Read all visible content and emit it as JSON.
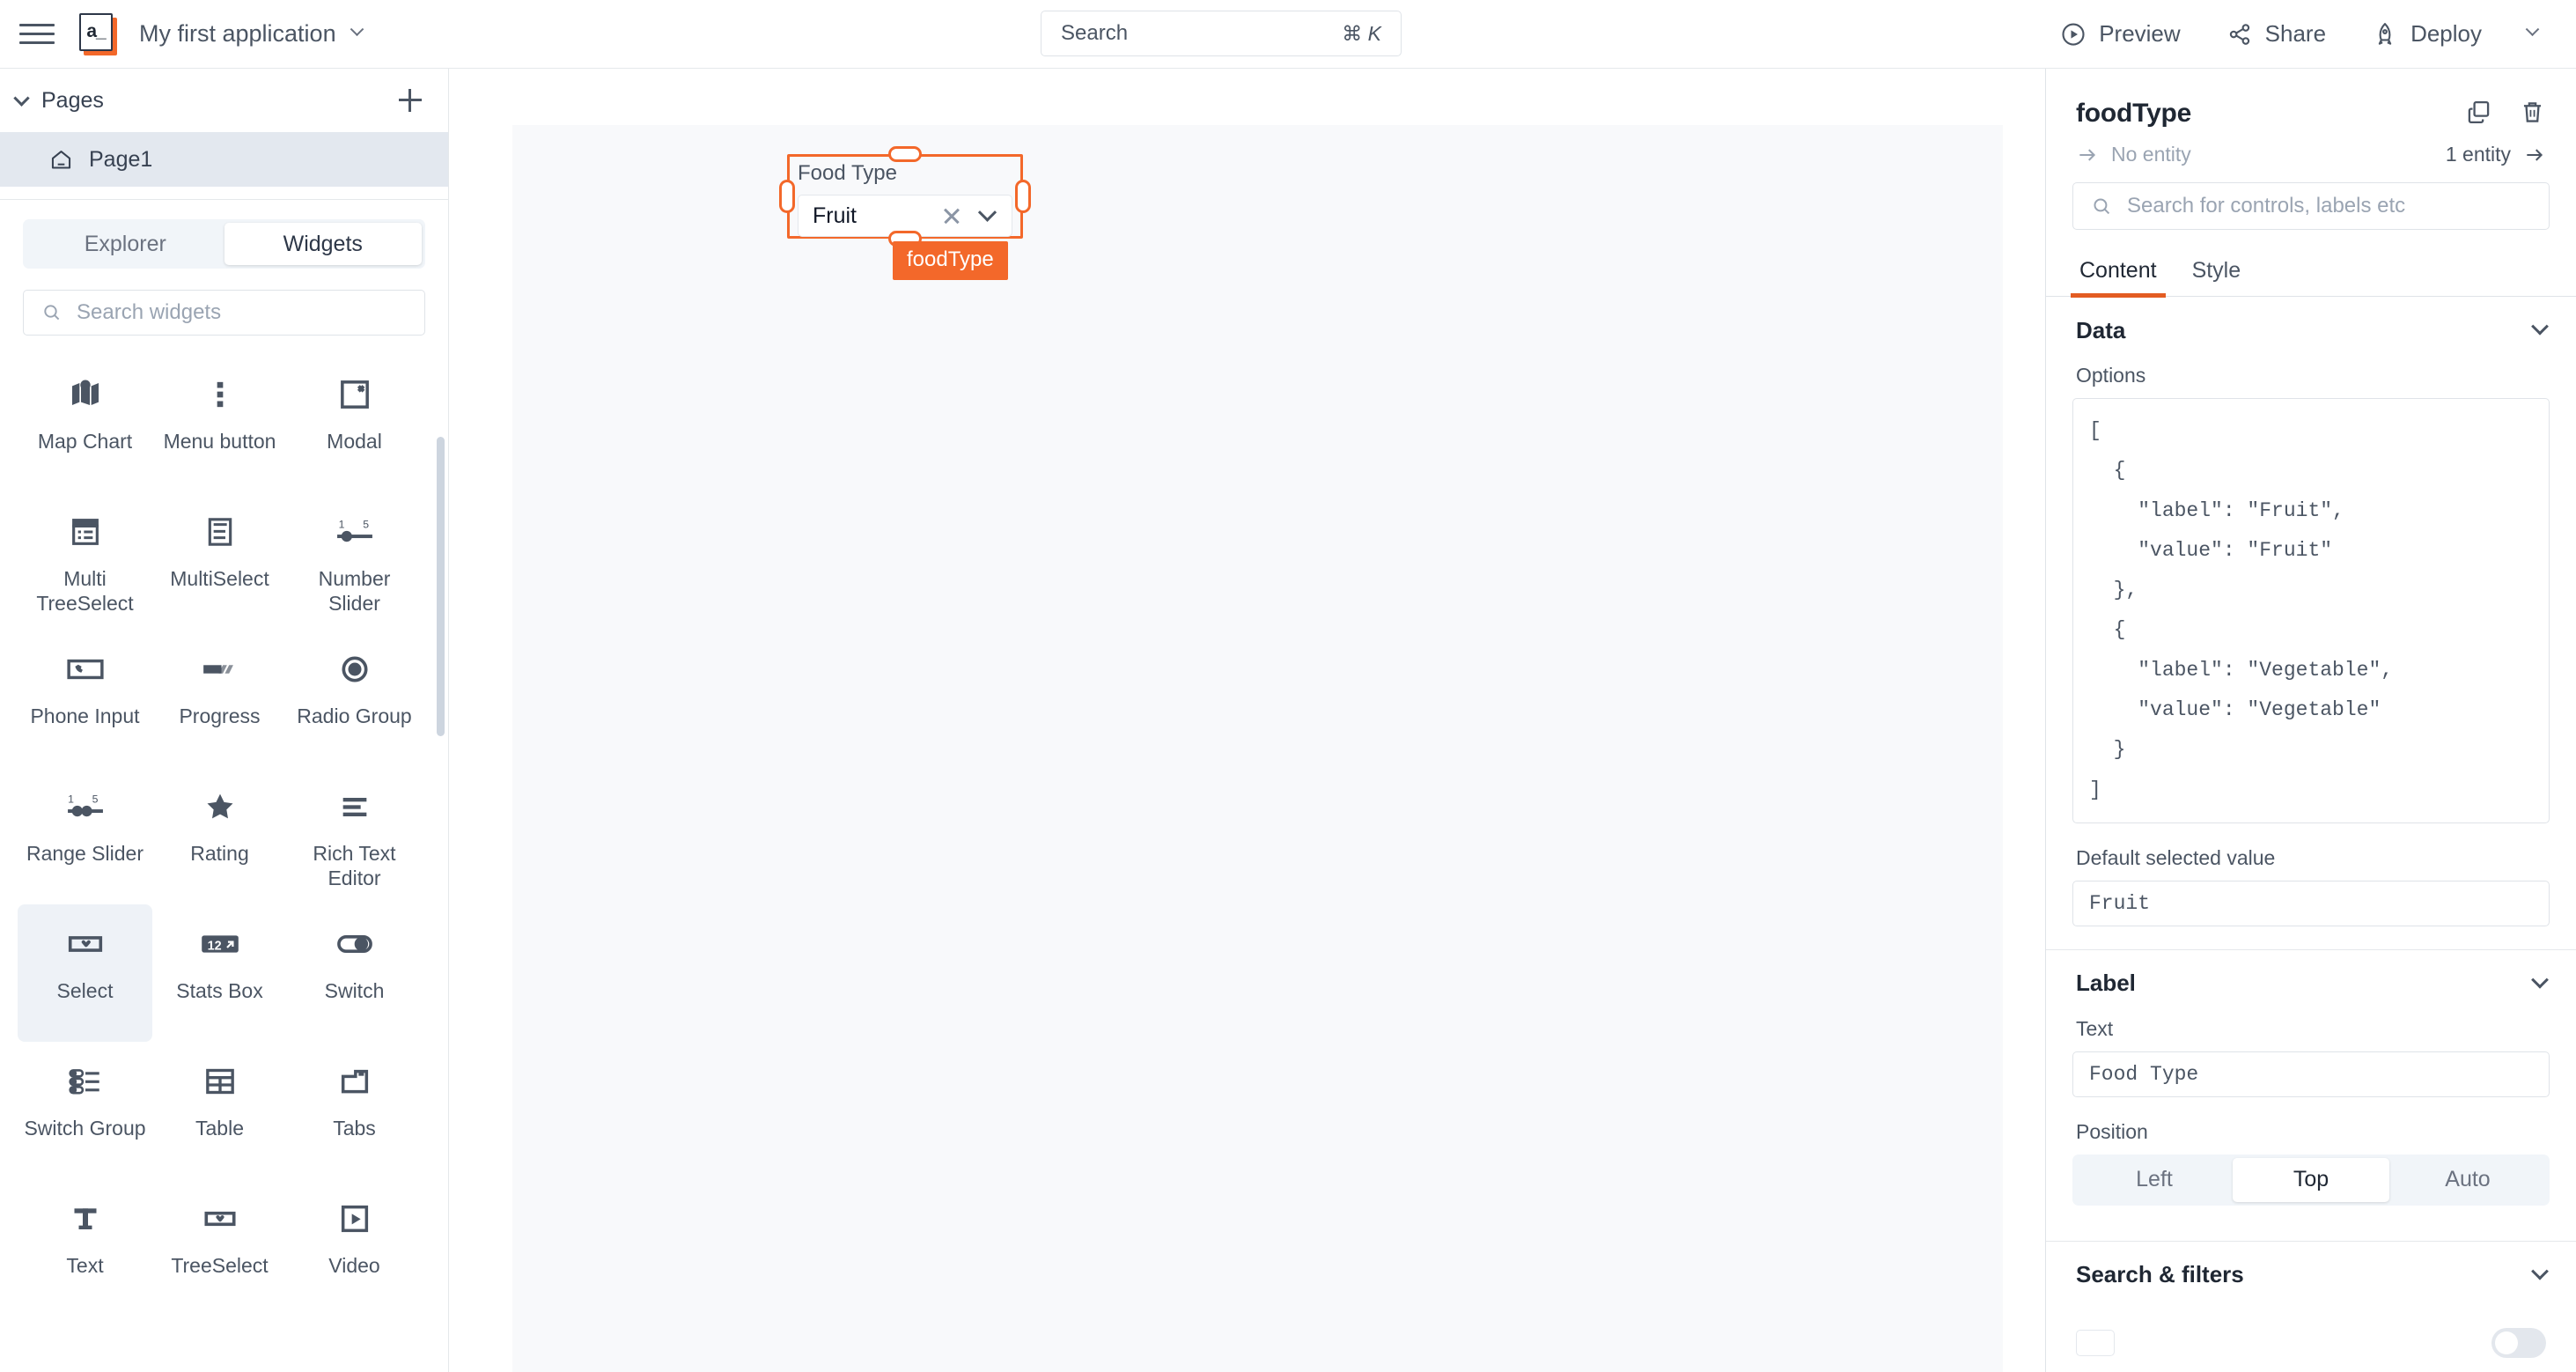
{
  "topbar": {
    "menu_icon": "hamburger-icon",
    "logo_text": "a_",
    "app_title": "My first application",
    "app_title_chevron": "chevron-down-icon",
    "search": {
      "placeholder": "Search",
      "shortcut_mod": "⌘",
      "shortcut_key": "K"
    },
    "actions": [
      {
        "label": "Preview",
        "icon": "play-circle-icon"
      },
      {
        "label": "Share",
        "icon": "share-nodes-icon"
      },
      {
        "label": "Deploy",
        "icon": "rocket-icon"
      }
    ],
    "more_chevron": "chevron-down-icon"
  },
  "sidebar": {
    "pages": {
      "title": "Pages",
      "collapse_icon": "chevron-down-icon",
      "add_icon": "plus-icon"
    },
    "page_items": [
      {
        "label": "Page1",
        "icon": "home-icon",
        "active": true
      }
    ],
    "tabs": [
      {
        "label": "Explorer",
        "active": false
      },
      {
        "label": "Widgets",
        "active": true
      }
    ],
    "search": {
      "placeholder": "Search widgets",
      "icon": "search-icon"
    },
    "widgets": [
      {
        "label": "Map Chart",
        "icon": "map-chart-icon",
        "selected": false
      },
      {
        "label": "Menu button",
        "icon": "dots-vertical-icon",
        "selected": false
      },
      {
        "label": "Modal",
        "icon": "modal-icon",
        "selected": false
      },
      {
        "label": "Multi TreeSelect",
        "icon": "multi-treeselect-icon",
        "selected": false
      },
      {
        "label": "MultiSelect",
        "icon": "multiselect-icon",
        "selected": false
      },
      {
        "label": "Number Slider",
        "icon": "number-slider-icon",
        "selected": false
      },
      {
        "label": "Phone Input",
        "icon": "phone-input-icon",
        "selected": false
      },
      {
        "label": "Progress",
        "icon": "progress-icon",
        "selected": false
      },
      {
        "label": "Radio Group",
        "icon": "radio-group-icon",
        "selected": false
      },
      {
        "label": "Range Slider",
        "icon": "range-slider-icon",
        "selected": false
      },
      {
        "label": "Rating",
        "icon": "star-icon",
        "selected": false
      },
      {
        "label": "Rich Text Editor",
        "icon": "rich-text-editor-icon",
        "selected": false
      },
      {
        "label": "Select",
        "icon": "select-icon",
        "selected": true
      },
      {
        "label": "Stats Box",
        "icon": "stats-box-icon",
        "selected": false
      },
      {
        "label": "Switch",
        "icon": "switch-icon",
        "selected": false
      },
      {
        "label": "Switch Group",
        "icon": "switch-group-icon",
        "selected": false
      },
      {
        "label": "Table",
        "icon": "table-icon",
        "selected": false
      },
      {
        "label": "Tabs",
        "icon": "tabs-icon",
        "selected": false
      },
      {
        "label": "Text",
        "icon": "text-icon",
        "selected": false
      },
      {
        "label": "TreeSelect",
        "icon": "treeselect-icon",
        "selected": false
      },
      {
        "label": "Video",
        "icon": "video-icon",
        "selected": false
      }
    ]
  },
  "canvas": {
    "widget": {
      "name_badge": "foodType",
      "label": "Food Type",
      "selected_value": "Fruit",
      "clear_icon": "close-icon",
      "dropdown_icon": "chevron-down-icon"
    }
  },
  "property_pane": {
    "title": "foodType",
    "copy_icon": "copy-icon",
    "delete_icon": "trash-icon",
    "bindings_left": {
      "label": "No entity",
      "icon": "arrow-right-icon"
    },
    "bindings_right": {
      "label": "1 entity",
      "icon": "arrow-right-icon"
    },
    "search": {
      "placeholder": "Search for controls, labels etc",
      "icon": "search-icon"
    },
    "tabs": [
      {
        "label": "Content",
        "active": true
      },
      {
        "label": "Style",
        "active": false
      }
    ],
    "data_section": {
      "title": "Data",
      "collapse_icon": "chevron-down-icon",
      "options_label": "Options",
      "options_code": "[\n  {\n    \"label\": \"Fruit\",\n    \"value\": \"Fruit\"\n  },\n  {\n    \"label\": \"Vegetable\",\n    \"value\": \"Vegetable\"\n  }\n]",
      "default_label": "Default selected value",
      "default_value": "Fruit"
    },
    "label_section": {
      "title": "Label",
      "collapse_icon": "chevron-down-icon",
      "text_label": "Text",
      "text_value": "Food  Type",
      "position_label": "Position",
      "position_options": [
        {
          "label": "Left",
          "active": false
        },
        {
          "label": "Top",
          "active": true
        },
        {
          "label": "Auto",
          "active": false
        }
      ]
    },
    "search_filters_section": {
      "title": "Search & filters",
      "collapse_icon": "chevron-down-icon"
    }
  },
  "colors": {
    "accent_orange": "#f3682a",
    "tab_underline": "#e35c22",
    "icon_slate": "#4b5563",
    "canvas_bg": "#f8f9fb",
    "selected_row": "#e3e8ef"
  }
}
